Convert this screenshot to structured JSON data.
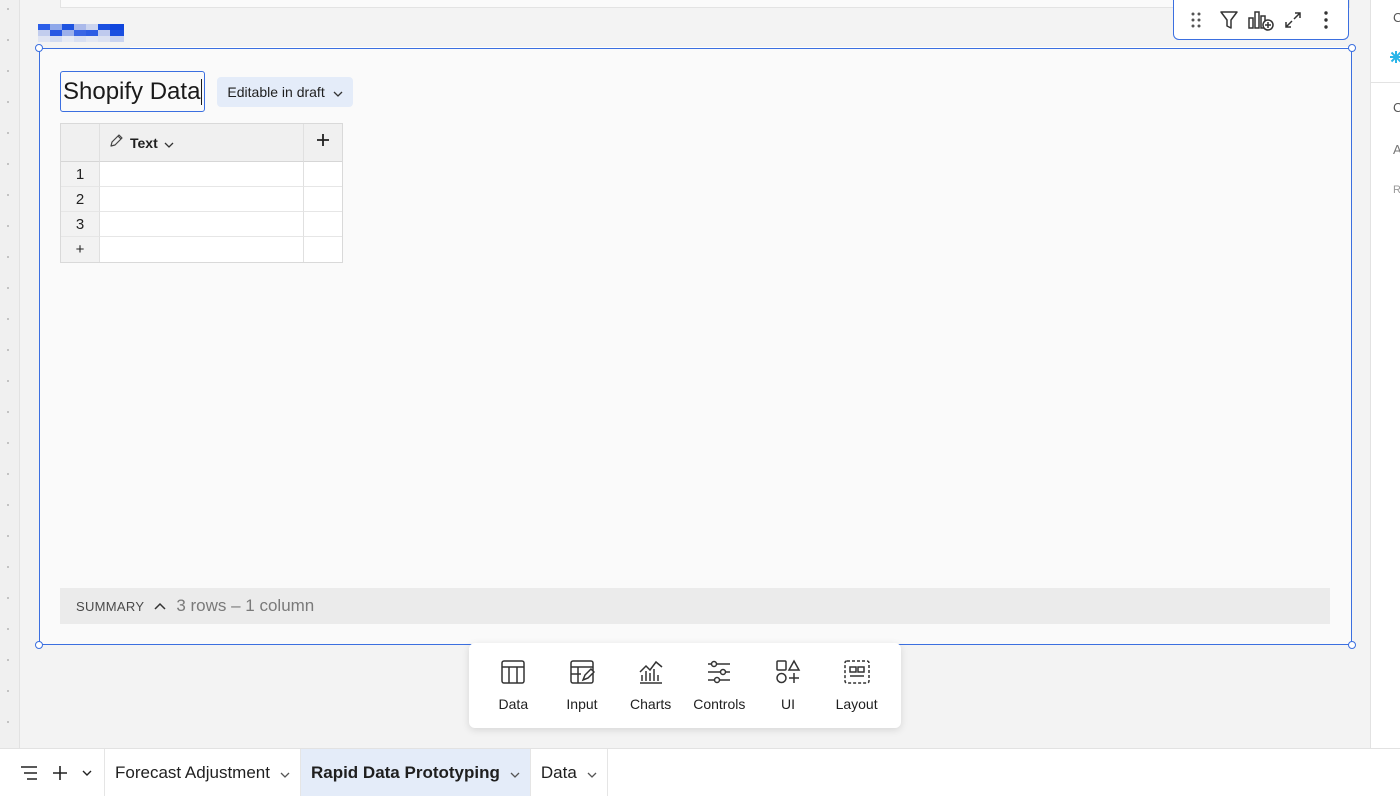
{
  "element": {
    "title": "Shopify Data",
    "badge_label": "Editable in draft"
  },
  "table": {
    "column_header": "Text",
    "rows": [
      {
        "index": "1"
      },
      {
        "index": "2"
      },
      {
        "index": "3"
      }
    ],
    "add_row_symbol": "+",
    "add_column_symbol": "+"
  },
  "summary": {
    "label": "SUMMARY",
    "info": "3 rows – 1 column"
  },
  "add_bar": {
    "items": [
      {
        "label": "Data",
        "icon": "table-icon"
      },
      {
        "label": "Input",
        "icon": "input-table-icon"
      },
      {
        "label": "Charts",
        "icon": "charts-icon"
      },
      {
        "label": "Controls",
        "icon": "sliders-icon"
      },
      {
        "label": "UI",
        "icon": "shapes-icon"
      },
      {
        "label": "Layout",
        "icon": "layout-icon"
      }
    ]
  },
  "toolbar": {
    "icons": [
      "drag-handle-icon",
      "filter-icon",
      "add-chart-icon",
      "expand-icon",
      "more-vertical-icon"
    ]
  },
  "right_panel": {
    "letters": [
      "C",
      "C",
      "A",
      "R"
    ]
  },
  "tabs": [
    {
      "label": "Forecast Adjustment",
      "active": false
    },
    {
      "label": "Rapid Data Prototyping",
      "active": true
    },
    {
      "label": "Data",
      "active": false
    }
  ],
  "colors": {
    "accent": "#3b6fe0",
    "active_tab_bg": "#e4ecf9",
    "badge_bg": "#e4ecf9"
  }
}
